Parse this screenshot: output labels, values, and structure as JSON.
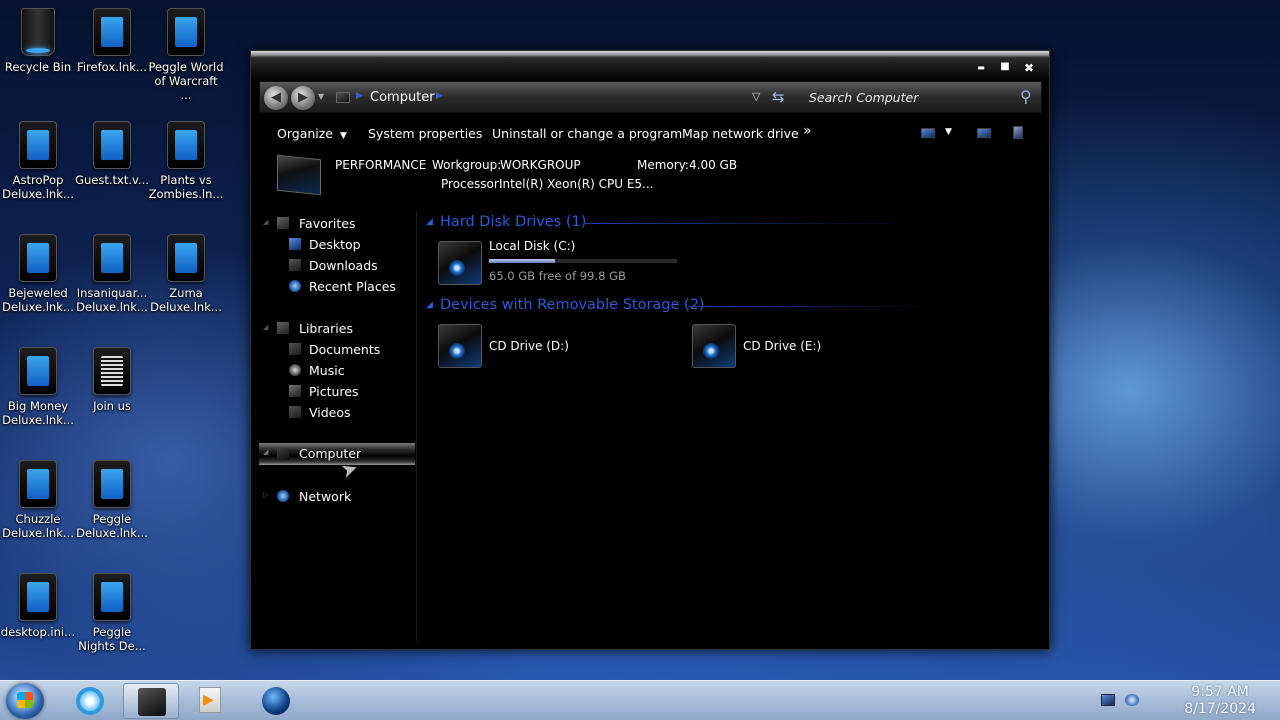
{
  "desktop": {
    "icons": [
      {
        "label": "Recycle Bin",
        "icon": "recycle-bin-icon"
      },
      {
        "label": "Firefox.lnk...",
        "icon": "shortcut-icon"
      },
      {
        "label": "Peggle World of Warcraft ...",
        "icon": "shortcut-icon"
      },
      {
        "label": "AstroPop Deluxe.lnk...",
        "icon": "shortcut-icon"
      },
      {
        "label": "Guest.txt.v...",
        "icon": "shortcut-icon"
      },
      {
        "label": "Plants vs Zombies.ln...",
        "icon": "shortcut-icon"
      },
      {
        "label": "Bejeweled Deluxe.lnk...",
        "icon": "shortcut-icon"
      },
      {
        "label": "Insaniquar... Deluxe.lnk...",
        "icon": "shortcut-icon"
      },
      {
        "label": "Zuma Deluxe.lnk...",
        "icon": "shortcut-icon"
      },
      {
        "label": "Big Money Deluxe.lnk...",
        "icon": "shortcut-icon"
      },
      {
        "label": "Join us",
        "icon": "document-icon"
      },
      {
        "label": "Chuzzle Deluxe.lnk...",
        "icon": "shortcut-icon"
      },
      {
        "label": "Peggle Deluxe.lnk...",
        "icon": "shortcut-icon"
      },
      {
        "label": "desktop.ini...",
        "icon": "shortcut-icon"
      },
      {
        "label": "Peggle Nights De...",
        "icon": "shortcut-icon"
      }
    ]
  },
  "window": {
    "controls": {
      "minimize": "▬",
      "maximize": "■",
      "close": "✖"
    },
    "address": {
      "location": "Computer",
      "search_placeholder": "Search Computer"
    },
    "toolbar": {
      "organize": "Organize",
      "system_properties": "System properties",
      "uninstall": "Uninstall or change a program",
      "map_drive": "Map network drive",
      "more": "»"
    },
    "info": {
      "computer_name": "PERFORMANCE",
      "workgroup_label": "Workgroup:",
      "workgroup_value": "WORKGROUP",
      "memory_label": "Memory:",
      "memory_value": "4.00 GB",
      "processor_label": "Processor:",
      "processor_value": "Intel(R) Xeon(R) CPU E5..."
    },
    "nav": {
      "favorites": "Favorites",
      "desktop": "Desktop",
      "downloads": "Downloads",
      "recent_places": "Recent Places",
      "libraries": "Libraries",
      "documents": "Documents",
      "music": "Music",
      "pictures": "Pictures",
      "videos": "Videos",
      "computer": "Computer",
      "network": "Network"
    },
    "content": {
      "hdd_header": "Hard Disk Drives (1)",
      "local_disk": "Local Disk (C:)",
      "local_disk_space": "65.0 GB free of 99.8 GB",
      "local_disk_used_fraction": 0.35,
      "removable_header": "Devices with Removable Storage (2)",
      "cd_d": "CD Drive (D:)",
      "cd_e": "CD Drive (E:)"
    }
  },
  "taskbar": {
    "time": "9:57 AM",
    "date": "8/17/2024"
  },
  "colors": {
    "group_header": "#2c5bd8",
    "window_bg": "#000000",
    "taskbar": "#a9bfd9"
  }
}
